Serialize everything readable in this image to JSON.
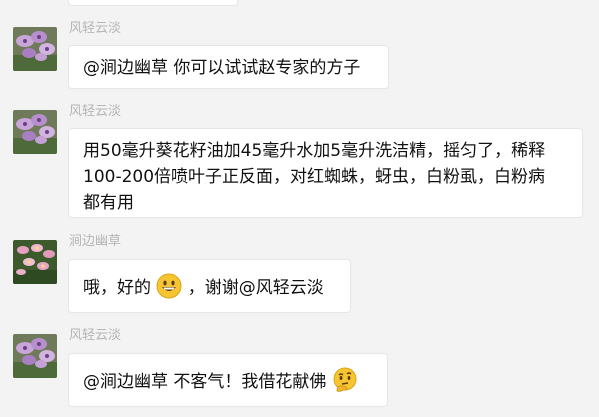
{
  "messages": [
    {
      "sender": "风轻云淡",
      "lines": [
        "@涧边幽草 你可以试试赵专家的方子"
      ]
    },
    {
      "sender": "风轻云淡",
      "lines": [
        "用50毫升葵花籽油加45毫升水加5毫升洗洁精，摇匀了，稀释",
        "100-200倍喷叶子正反面，对红蜘蛛，蚜虫，白粉虱，白粉病",
        "都有用"
      ]
    },
    {
      "sender": "涧边幽草",
      "text_before_emoji": "哦，好的",
      "emoji": "grinning-face",
      "text_after_emoji": " ，谢谢@风轻云淡"
    },
    {
      "sender": "风轻云淡",
      "text_before_emoji": "@涧边幽草 不客气！我借花献佛",
      "emoji": "thinking-face"
    }
  ],
  "colors": {
    "background": "#f3f3f3",
    "bubble": "#ffffff",
    "sender_name": "#b5b5b5",
    "emoji_yellow": "#f7c531"
  }
}
